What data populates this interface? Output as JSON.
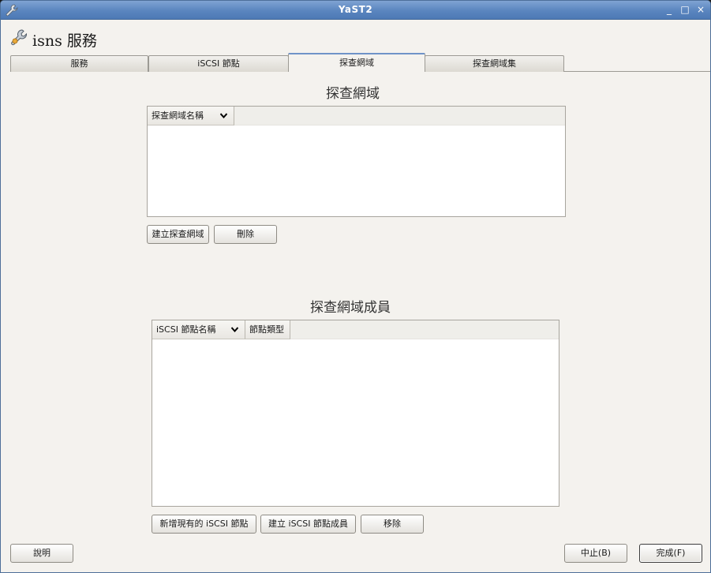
{
  "window": {
    "title": "YaST2",
    "controls": {
      "minimize": "_",
      "maximize": "□",
      "close": "×"
    }
  },
  "header": {
    "title": "isns 服務",
    "icon": "wrench-icon"
  },
  "tabs": [
    {
      "label": "服務",
      "active": false
    },
    {
      "label": "iSCSI 節點",
      "active": false
    },
    {
      "label": "探查網域",
      "active": true
    },
    {
      "label": "探查網域集",
      "active": false
    }
  ],
  "domains": {
    "title": "探查網域",
    "columns": [
      "探查網域名稱"
    ],
    "buttons": {
      "create": "建立探查網域",
      "delete": "刪除"
    }
  },
  "members": {
    "title": "探查網域成員",
    "columns": [
      "iSCSI 節點名稱",
      "節點類型"
    ],
    "buttons": {
      "add_existing": "新增現有的 iSCSI 節點",
      "create_member": "建立 iSCSI 節點成員",
      "remove": "移除"
    }
  },
  "footer": {
    "help": "說明",
    "abort": "中止(B)",
    "finish": "完成(F)"
  },
  "colors": {
    "titlebar": "#5a85bf",
    "background": "#f4f2ee",
    "active_tab": "#6f93c8"
  }
}
